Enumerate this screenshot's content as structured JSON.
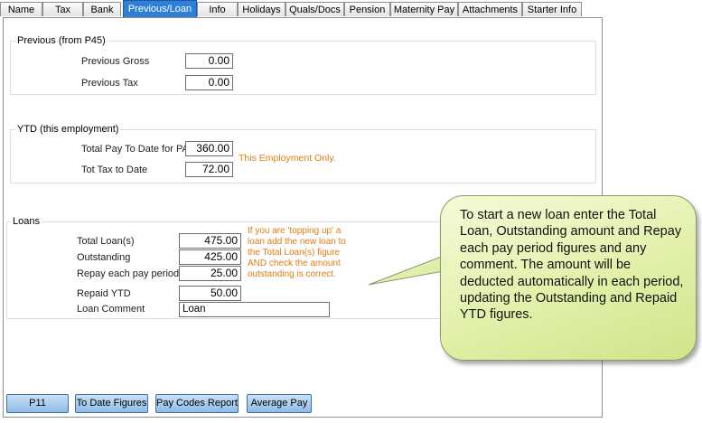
{
  "tabs": [
    {
      "label": "Name"
    },
    {
      "label": "Tax"
    },
    {
      "label": "Bank"
    },
    {
      "label": "Previous/Loan"
    },
    {
      "label": "Info"
    },
    {
      "label": "Holidays"
    },
    {
      "label": "Quals/Docs"
    },
    {
      "label": "Pension"
    },
    {
      "label": "Maternity Pay"
    },
    {
      "label": "Attachments"
    },
    {
      "label": "Starter Info"
    }
  ],
  "active_tab": "Previous/Loan",
  "previous": {
    "title": "Previous (from P45)",
    "gross_label": "Previous Gross",
    "gross_value": "0.00",
    "tax_label": "Previous Tax",
    "tax_value": "0.00"
  },
  "ytd": {
    "title": "YTD (this employment)",
    "pay_label": "Total Pay To Date for PAYE",
    "pay_value": "360.00",
    "tax_label": "Tot Tax to Date",
    "tax_value": "72.00",
    "note": "This Employment Only."
  },
  "loans": {
    "title": "Loans",
    "total_label": "Total Loan(s)",
    "total_value": "475.00",
    "outstanding_label": "Outstanding",
    "outstanding_value": "425.00",
    "repay_label": "Repay each pay period",
    "repay_value": "25.00",
    "repaid_label": "Repaid YTD",
    "repaid_value": "50.00",
    "comment_label": "Loan Comment",
    "comment_value": "Loan",
    "note_lines": [
      "If you are 'topping up' a",
      "loan add the new loan to",
      "the Total Loan(s) figure",
      "AND check the amount",
      "outstanding is correct."
    ]
  },
  "buttons": {
    "p11": "P11",
    "to_date": "To Date Figures",
    "pay_codes": "Pay Codes Report",
    "average_pay": "Average Pay"
  },
  "callout": {
    "text": "To start a new loan enter the Total Loan, Outstanding amount and Repay each pay period figures and any comment. The amount will be deducted automatically in each period, updating the Outstanding and Repaid YTD figures."
  },
  "colors": {
    "active_tab": "#2f7fd6",
    "note": "#e07b10",
    "button": "#a9cdf0",
    "callout": "#e2f0a9"
  }
}
